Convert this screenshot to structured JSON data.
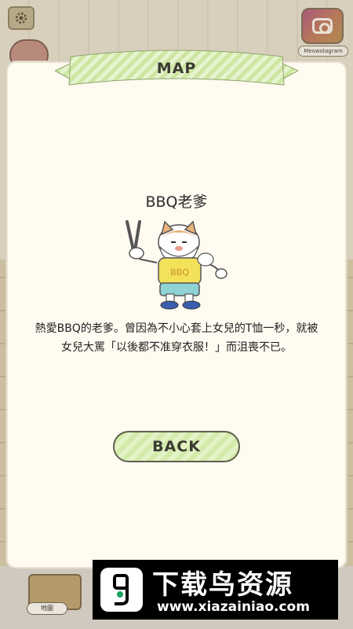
{
  "scene": {
    "instagram_label": "Meowstagram",
    "map_button_label": "地圖"
  },
  "dialog": {
    "title": "MAP",
    "character_name": "BBQ老爹",
    "shirt_text": "BBQ",
    "description": "熱愛BBQ的老爹。曾因為不小心套上女兒的T恤一秒，就被女兒大罵「以後都不准穿衣服！」而沮喪不已。",
    "back_label": "BACK"
  },
  "watermark": {
    "title": "下载鸟资源",
    "url": "www.xiazainiao.com"
  },
  "colors": {
    "dialog_bg": "#fffbf1",
    "ribbon_green": "#d3ebaa",
    "button_green": "#d3ebaa"
  }
}
